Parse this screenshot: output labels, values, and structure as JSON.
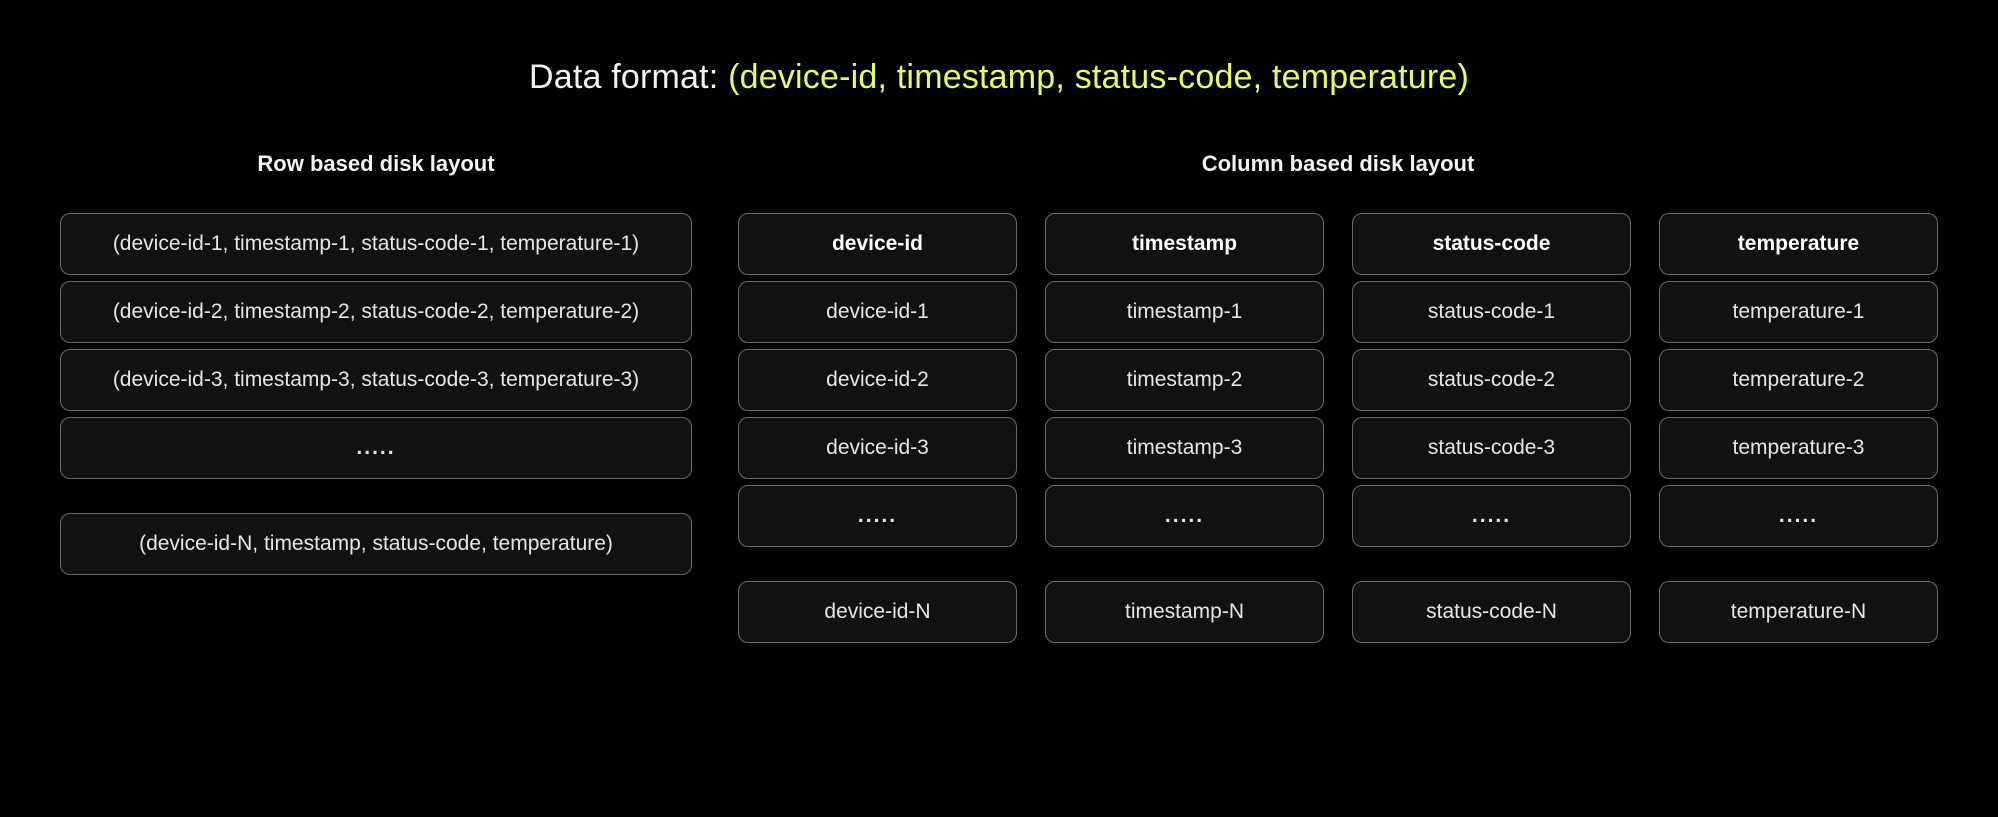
{
  "title": {
    "prefix": "Data format: ",
    "highlight": "(device-id, timestamp, status-code, temperature)"
  },
  "left": {
    "heading": "Row based disk layout",
    "rows": [
      "(device-id-1, timestamp-1, status-code-1, temperature-1)",
      "(device-id-2, timestamp-2, status-code-2, temperature-2)",
      "(device-id-3, timestamp-3, status-code-3, temperature-3)",
      "....."
    ],
    "last_row": "(device-id-N, timestamp, status-code, temperature)"
  },
  "right": {
    "heading": "Column based disk layout",
    "columns": [
      {
        "header": "device-id",
        "cells": [
          "device-id-1",
          "device-id-2",
          "device-id-3",
          "....."
        ],
        "last": "device-id-N"
      },
      {
        "header": "timestamp",
        "cells": [
          "timestamp-1",
          "timestamp-2",
          "timestamp-3",
          "....."
        ],
        "last": "timestamp-N"
      },
      {
        "header": "status-code",
        "cells": [
          "status-code-1",
          "status-code-2",
          "status-code-3",
          "....."
        ],
        "last": "status-code-N"
      },
      {
        "header": "temperature",
        "cells": [
          "temperature-1",
          "temperature-2",
          "temperature-3",
          "....."
        ],
        "last": "temperature-N"
      }
    ]
  }
}
